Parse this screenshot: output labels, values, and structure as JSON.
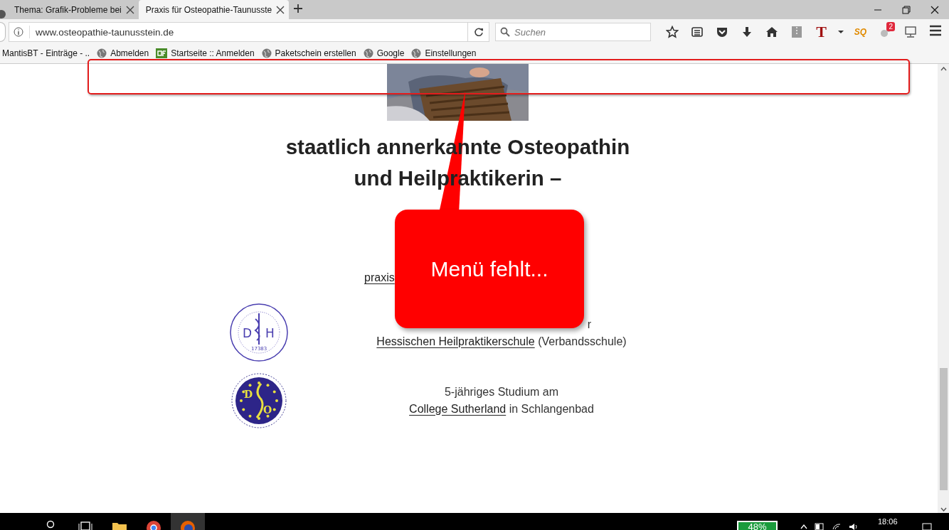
{
  "browser": {
    "tabs": [
      {
        "title": "Thema: Grafik-Probleme bei",
        "selected": false
      },
      {
        "title": "Praxis für Osteopathie-Taunusste",
        "selected": true
      }
    ],
    "address": "www.osteopathie-taunusstein.de",
    "search": {
      "placeholder": "Suchen"
    },
    "toolbar": [
      {
        "kind": "star"
      },
      {
        "kind": "reader"
      },
      {
        "kind": "pocket"
      },
      {
        "kind": "download"
      },
      {
        "kind": "home"
      },
      {
        "kind": "zip"
      },
      {
        "kind": "letter",
        "text": "T"
      },
      {
        "kind": "caret"
      },
      {
        "kind": "letter-logo",
        "text": "SQ"
      },
      {
        "kind": "addon",
        "badge": "2"
      },
      {
        "kind": "monitor"
      }
    ],
    "bookmarks": [
      {
        "title": "MantisBT - Einträge - ..",
        "kind": "plain"
      },
      {
        "title": "Abmelden",
        "kind": "globe"
      },
      {
        "title": "Startseite :: Anmelden",
        "kind": "site"
      },
      {
        "title": "Paketschein erstellen",
        "kind": "globe"
      },
      {
        "title": "Google",
        "kind": "globe"
      },
      {
        "title": "Einstellungen",
        "kind": "globe"
      }
    ]
  },
  "page": {
    "heading": [
      "staatlich annerkannte Osteopathin",
      "und Heilpraktikerin –"
    ],
    "contact_link": "praxis",
    "schools": [
      {
        "kind": "stamp",
        "logo_letters": [
          "D",
          "H"
        ],
        "logo_number": "17383",
        "lines": [
          {
            "fragment": "r"
          },
          {
            "link": "Hessischen Heilpraktikerschule",
            "after": "(Verbandsschule)"
          }
        ]
      },
      {
        "kind": "star-seal",
        "logo_letters": [
          "D",
          "O"
        ],
        "lines": [
          {
            "text": "5-jähriges Studium am"
          },
          {
            "link": "College Sutherland",
            "after": "in Schlangenbad"
          }
        ]
      }
    ]
  },
  "annotations": {
    "highlight_box": true,
    "callout": {
      "text": "Menü fehlt..."
    }
  },
  "taskbar": {
    "battery": "48%",
    "clock": "18:06"
  }
}
